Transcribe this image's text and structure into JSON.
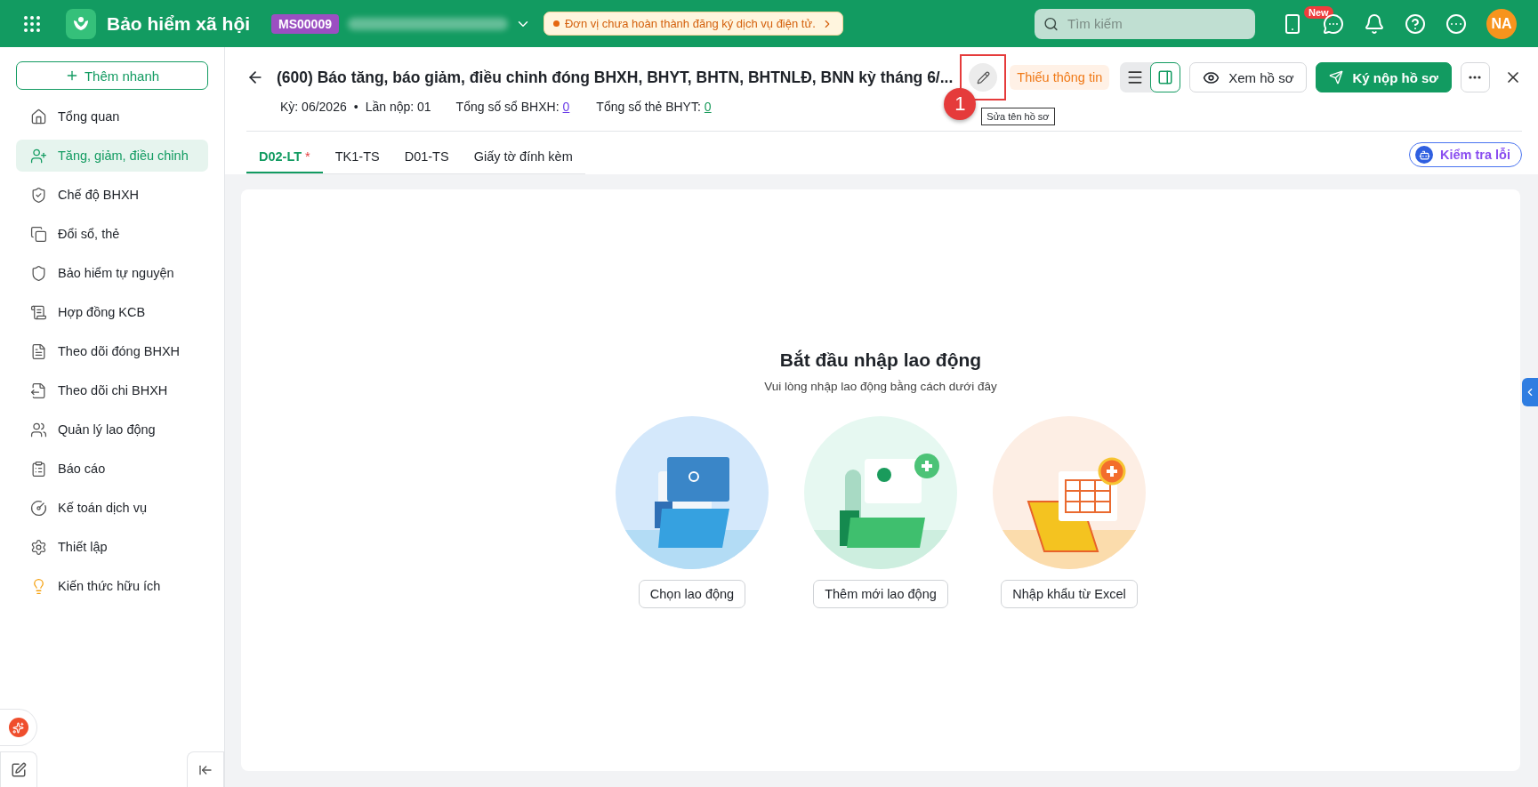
{
  "topbar": {
    "app_title": "Bảo hiểm xã hội",
    "unit_code": "MS00009",
    "notice": "Đơn vị chưa hoàn thành đăng ký dịch vụ điện tử.",
    "search": {
      "placeholder": "Tìm kiếm"
    },
    "new_badge": "New",
    "avatar": "NA"
  },
  "sidebar": {
    "quick_add": "Thêm nhanh",
    "items": [
      {
        "label": "Tổng quan",
        "selected": false
      },
      {
        "label": "Tăng, giảm, điều chỉnh",
        "selected": true
      },
      {
        "label": "Chế độ BHXH",
        "selected": false
      },
      {
        "label": "Đổi sổ, thẻ",
        "selected": false
      },
      {
        "label": "Bảo hiểm tự nguyện",
        "selected": false
      },
      {
        "label": "Hợp đồng KCB",
        "selected": false
      },
      {
        "label": "Theo dõi đóng BHXH",
        "selected": false
      },
      {
        "label": "Theo dõi chi BHXH",
        "selected": false
      },
      {
        "label": "Quản lý lao động",
        "selected": false
      },
      {
        "label": "Báo cáo",
        "selected": false
      },
      {
        "label": "Kế toán dịch vụ",
        "selected": false
      },
      {
        "label": "Thiết lập",
        "selected": false
      },
      {
        "label": "Kiến thức hữu ích",
        "selected": false
      }
    ]
  },
  "header": {
    "title": "(600) Báo tăng, báo giảm, điều chỉnh đóng BHXH, BHYT, BHTN, BHTNLĐ, BNN kỳ tháng 6/...",
    "status": "Thiếu thông tin",
    "tooltip": "Sửa tên hồ sơ",
    "step_badge": "1",
    "view_toggle": [
      {
        "selected": false
      },
      {
        "selected": true
      }
    ],
    "actions": [
      {
        "kind": "outline",
        "label": "Xem hồ sơ"
      },
      {
        "kind": "primary",
        "label": "Ký nộp hồ sơ"
      }
    ],
    "meta": [
      {
        "kind": "text",
        "text": "Kỳ: 06/2026"
      },
      {
        "kind": "bullet",
        "text": "•"
      },
      {
        "kind": "text",
        "text": "Lần nộp: 01"
      },
      {
        "kind": "count",
        "text": "Tổng số sổ BHXH:",
        "value": "0",
        "color": "#6a3de8"
      },
      {
        "kind": "count",
        "text": "Tổng số thẻ BHYT:",
        "value": "0",
        "color": "#1a9b5c"
      }
    ]
  },
  "tabs": [
    {
      "label": "D02-LT",
      "marker": "*",
      "selected": true
    },
    {
      "label": "TK1-TS",
      "selected": false
    },
    {
      "label": "D01-TS",
      "selected": false
    },
    {
      "label": "Giấy tờ đính kèm",
      "selected": false
    }
  ],
  "check_button": "Kiểm tra lỗi",
  "empty_state": {
    "title": "Bắt đầu nhập lao động",
    "subtitle": "Vui lòng nhập lao động bằng cách dưới đây",
    "options": [
      {
        "kind": "select",
        "label": "Chọn lao động"
      },
      {
        "kind": "create",
        "label": "Thêm mới lao động"
      },
      {
        "kind": "import",
        "label": "Nhập khẩu từ Excel"
      }
    ]
  }
}
